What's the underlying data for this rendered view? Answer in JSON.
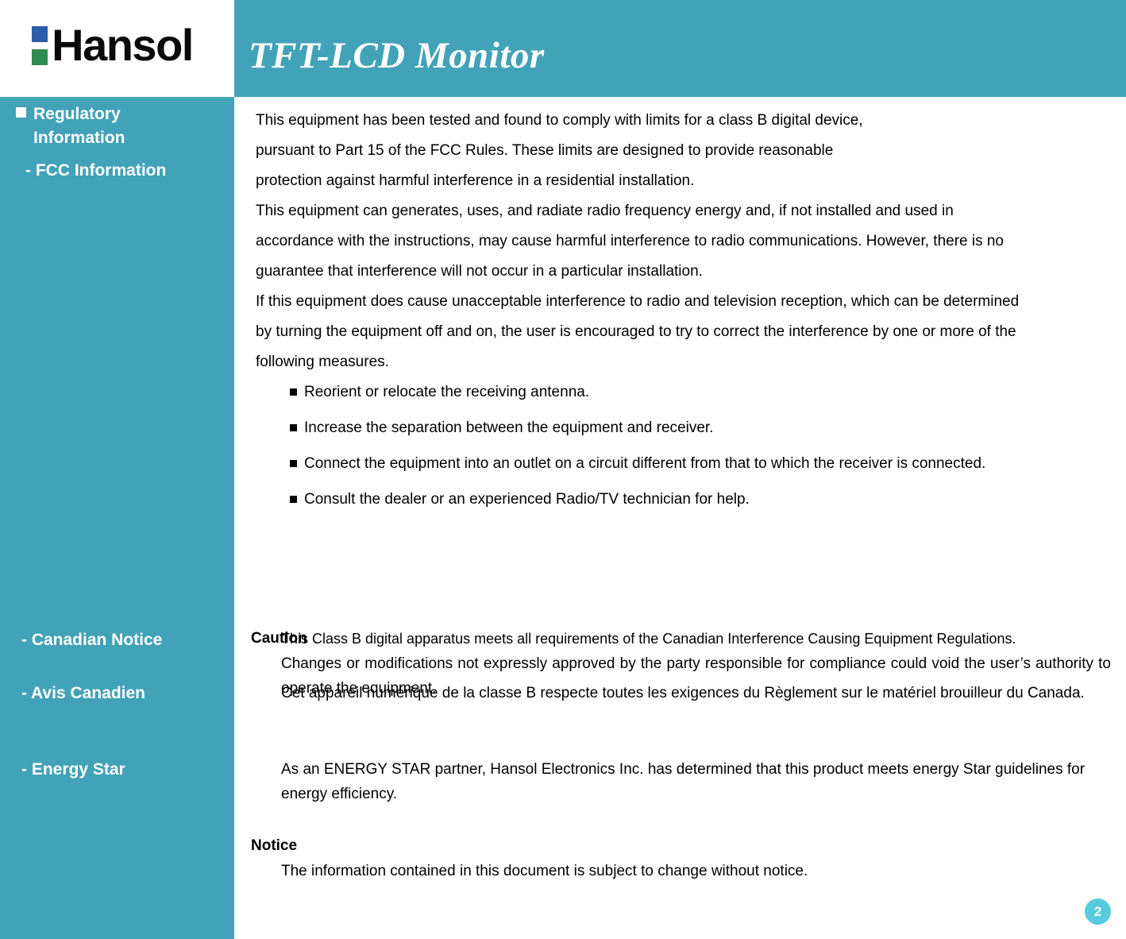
{
  "header": {
    "logo": {
      "brand": "Hansol",
      "square_top_color": "#2a5caa",
      "square_bottom_color": "#2e8b50"
    },
    "title": "TFT-LCD Monitor",
    "band_color": "#42a2b8"
  },
  "sidebar": {
    "background_color": "#42a2b8",
    "heading_line1": "Regulatory",
    "heading_line2": "Information",
    "items": [
      {
        "label": "- FCC Information"
      },
      {
        "label": "- Canadian Notice"
      },
      {
        "label": "- Avis Canadien"
      },
      {
        "label": "- Energy Star"
      }
    ]
  },
  "main": {
    "intro": [
      "This equipment has been tested and found to comply with limits for a class B digital device,",
      "pursuant to Part 15 of the FCC Rules. These limits are designed to provide reasonable",
      "protection against harmful interference in a residential installation.",
      "This equipment can generates, uses, and radiate radio frequency energy and, if not installed and used in",
      "accordance with the instructions, may cause harmful interference to radio communications. However, there is no",
      "guarantee that interference will not occur in a particular installation.",
      "If this equipment does cause unacceptable interference to radio and television reception, which can be determined",
      "by turning the equipment off and on, the user is encouraged to try to correct the interference by one or more of the",
      "following measures."
    ],
    "measures": [
      "Reorient or relocate the receiving antenna.",
      "Increase the separation between the equipment and receiver.",
      "Connect the equipment into an outlet on a circuit different from that to which the receiver is connected.",
      "Consult the dealer or an experienced Radio/TV technician for help."
    ],
    "caution": {
      "heading": "Caution",
      "body": "Changes or modifications not expressly approved by the party responsible for compliance could void the user’s authority to operate the equipment."
    },
    "canadian_notice": {
      "body": "This Class B digital apparatus meets all requirements of the Canadian Interference Causing Equipment Regulations."
    },
    "avis_canadien": {
      "body": "Cet appareil numérique de la classe B respecte toutes les exigences du Règlement sur le matériel brouilleur du Canada."
    },
    "energy_star": {
      "body": "As an ENERGY STAR partner, Hansol Electronics Inc. has determined that this product meets energy Star guidelines for energy efficiency."
    },
    "notice": {
      "heading": "Notice",
      "body": "The information contained in this document is subject to change without notice."
    }
  },
  "footer": {
    "page_number": "2",
    "badge_color": "#58cbdd"
  }
}
